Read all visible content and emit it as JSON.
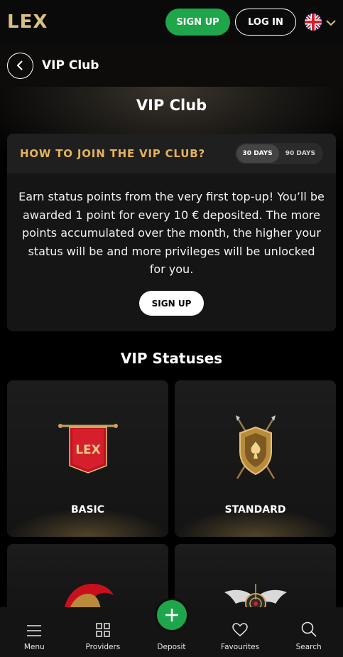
{
  "header": {
    "logo": "LEX",
    "signup_label": "SIGN UP",
    "login_label": "LOG IN",
    "language_icon": "uk-flag-icon"
  },
  "page": {
    "back_icon": "chevron-left-icon",
    "breadcrumb_title": "VIP Club",
    "hero_title": "VIP Club"
  },
  "join": {
    "title": "HOW TO JOIN THE VIP CLUB?",
    "periods": [
      "30 DAYS",
      "90 DAYS"
    ],
    "selected_period": "30 DAYS",
    "text": "Earn status points from the very first top-up! You’ll be awarded 1 point for every 10 € deposited. The more points accumulated over the month, the higher your status will be and more privileges will be unlocked for you.",
    "signup_label": "SIGN UP"
  },
  "statuses": {
    "title": "VIP Statuses",
    "items": [
      {
        "name": "BASIC",
        "badge_text": "LEX"
      },
      {
        "name": "STANDARD"
      },
      {
        "name": ""
      },
      {
        "name": ""
      }
    ]
  },
  "bottom_nav": {
    "items": [
      {
        "label": "Menu",
        "icon": "menu-icon"
      },
      {
        "label": "Providers",
        "icon": "grid-icon"
      },
      {
        "label": "Deposit",
        "icon": "plus-icon"
      },
      {
        "label": "Favourites",
        "icon": "heart-icon"
      },
      {
        "label": "Search",
        "icon": "search-icon"
      }
    ]
  },
  "colors": {
    "accent_green": "#1fa54a",
    "gold": "#e3b25a",
    "logo_gold": "#d9c07e"
  }
}
